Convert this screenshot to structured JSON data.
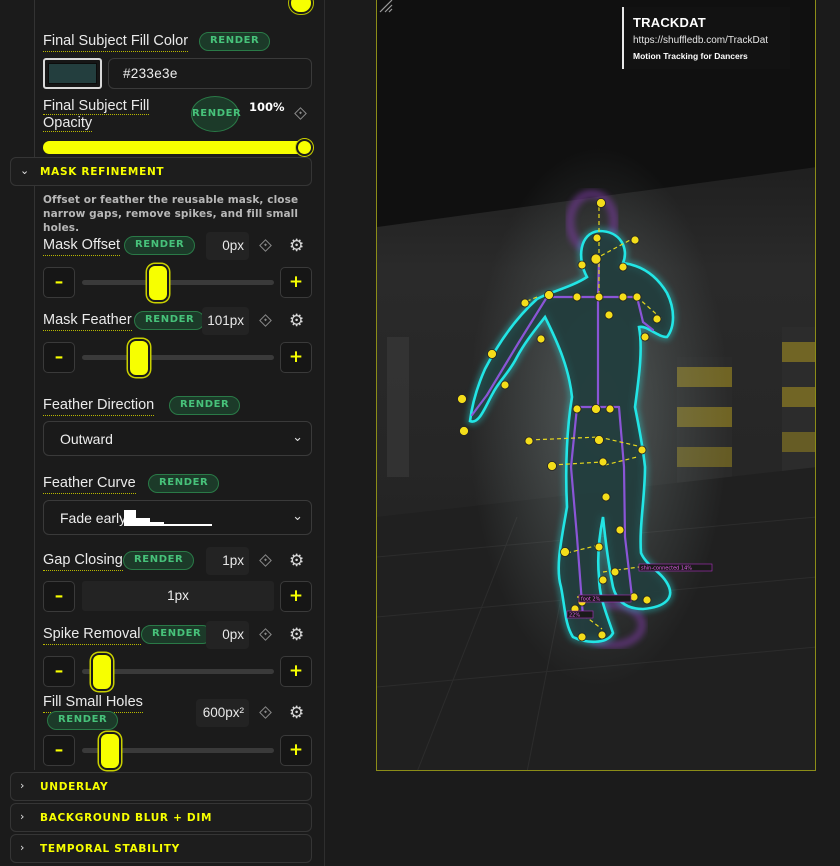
{
  "fill_color": {
    "label": "Final Subject Fill Color",
    "badge": "RENDER",
    "hex_value": "#233e3e",
    "swatch_color": "#233e3e"
  },
  "fill_opacity": {
    "label": "Final Subject Fill Opacity",
    "badge": "RENDER",
    "value": "100%",
    "level": 1.0
  },
  "mask_refinement": {
    "title": "MASK REFINEMENT",
    "description": "Offset or feather the reusable mask, close narrow gaps, remove spikes, and fill small holes.",
    "mask_offset": {
      "label": "Mask Offset",
      "badge": "RENDER",
      "value": "0",
      "unit": "px",
      "level": 0.38
    },
    "mask_feather": {
      "label": "Mask Feather",
      "badge": "RENDER",
      "value": "101",
      "unit": "px",
      "level": 0.27
    },
    "feather_direction": {
      "label": "Feather Direction",
      "badge": "RENDER",
      "selected": "Outward"
    },
    "feather_curve": {
      "label": "Feather Curve",
      "badge": "RENDER",
      "selected": "Fade early"
    },
    "gap_closing": {
      "label": "Gap Closing",
      "badge": "RENDER",
      "value": "1",
      "unit": "px",
      "slider_text": "1px"
    },
    "spike_removal": {
      "label": "Spike Removal",
      "badge": "RENDER",
      "value": "0",
      "unit": "px",
      "level": 0.05
    },
    "fill_small_holes": {
      "label": "Fill Small Holes",
      "badge": "RENDER",
      "value": "600",
      "unit": "px²",
      "level": 0.1
    }
  },
  "stepper": {
    "minus": "–",
    "plus": "+"
  },
  "collapsed_sections": [
    "UNDERLAY",
    "BACKGROUND BLUR + DIM",
    "TEMPORAL STABILITY"
  ],
  "overlay": {
    "title": "TRACKDAT",
    "url": "https://shuffledb.com/TrackDat",
    "tagline": "Motion Tracking for Dancers"
  },
  "skeleton_tags": [
    "shin-connected 14%",
    "foot 2%",
    "22%"
  ],
  "icons": {
    "expanded": "chevron-down-icon",
    "collapsed": "chevron-right-icon",
    "keyframe": "keyframe-diamond-icon",
    "settings": "gear-icon",
    "dropdown": "chevron-down-icon",
    "resize": "resize-grip-icon"
  },
  "colors": {
    "accent": "#f7ff00",
    "render_badge": "#47c27a",
    "mask_outline": "#22e5e5",
    "skeleton_line": "#8a55d6"
  }
}
